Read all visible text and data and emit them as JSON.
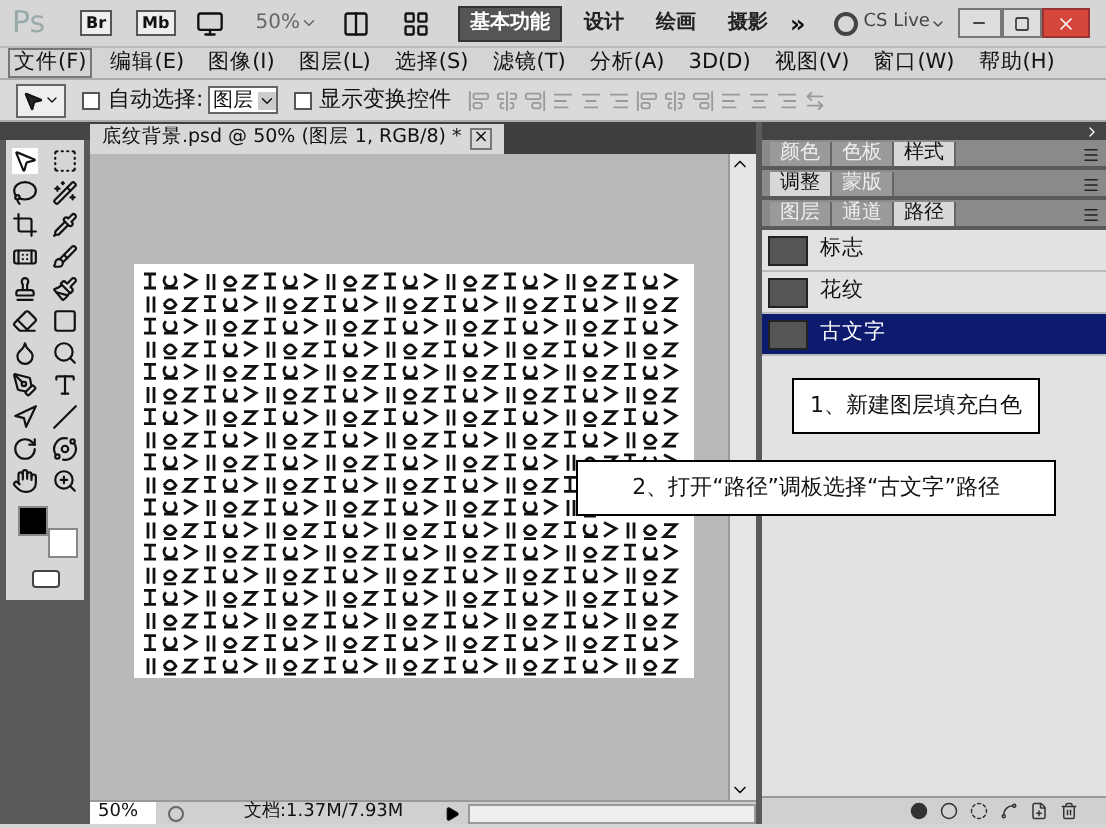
{
  "app_bar": {
    "logo": "Ps",
    "bridge": "Br",
    "mini_bridge": "Mb",
    "zoom": "50%",
    "workspaces": [
      {
        "label": "基本功能",
        "selected": true
      },
      {
        "label": "设计",
        "selected": false
      },
      {
        "label": "绘画",
        "selected": false
      },
      {
        "label": "摄影",
        "selected": false
      }
    ],
    "more": "»",
    "cs_live": "CS Live"
  },
  "menu": [
    {
      "label": "文件(F)",
      "selected": true
    },
    {
      "label": "编辑(E)",
      "selected": false
    },
    {
      "label": "图像(I)",
      "selected": false
    },
    {
      "label": "图层(L)",
      "selected": false
    },
    {
      "label": "选择(S)",
      "selected": false
    },
    {
      "label": "滤镜(T)",
      "selected": false
    },
    {
      "label": "分析(A)",
      "selected": false
    },
    {
      "label": "3D(D)",
      "selected": false
    },
    {
      "label": "视图(V)",
      "selected": false
    },
    {
      "label": "窗口(W)",
      "selected": false
    },
    {
      "label": "帮助(H)",
      "selected": false
    }
  ],
  "options_bar": {
    "auto_select": {
      "label": "自动选择:",
      "checked": false
    },
    "auto_select_target": "图层",
    "show_transform": {
      "label": "显示变换控件",
      "checked": false
    }
  },
  "document": {
    "tab_title": "底纹背景.psd @ 50% (图层 1, RGB/8) *",
    "close": "×",
    "zoom": "50%",
    "status": "文档:1.37M/7.93M"
  },
  "panel_groups": [
    {
      "tabs": [
        {
          "label": "颜色",
          "selected": false
        },
        {
          "label": "色板",
          "selected": false
        },
        {
          "label": "样式",
          "selected": true
        }
      ]
    },
    {
      "tabs": [
        {
          "label": "调整",
          "selected": true
        },
        {
          "label": "蒙版",
          "selected": false
        }
      ]
    },
    {
      "tabs": [
        {
          "label": "图层",
          "selected": false
        },
        {
          "label": "通道",
          "selected": false
        },
        {
          "label": "路径",
          "selected": true
        }
      ]
    }
  ],
  "paths": [
    {
      "name": "标志",
      "selected": false
    },
    {
      "name": "花纹",
      "selected": false
    },
    {
      "name": "古文字",
      "selected": true
    }
  ],
  "callouts": [
    "1、新建图层填充白色",
    "2、打开“路径”调板选择“古文字”路径"
  ]
}
